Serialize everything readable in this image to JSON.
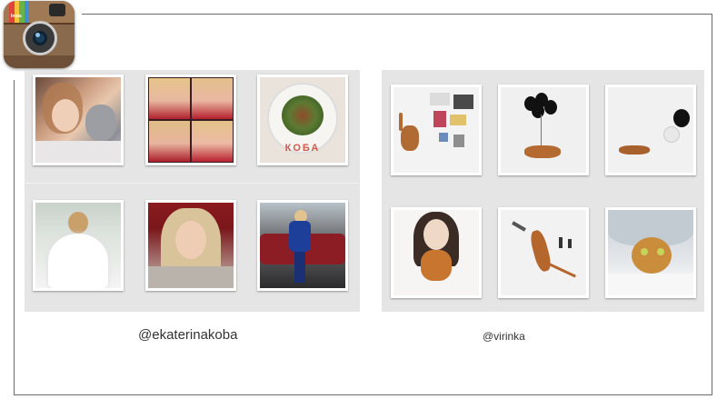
{
  "colors": {
    "frame": "#6b6b6b",
    "panel": "#e5e5e5",
    "text": "#333333"
  },
  "app_icon": {
    "name": "instagram-icon",
    "label": "Insta"
  },
  "profiles": [
    {
      "handle": "@ekaterinakoba",
      "photos": [
        {
          "name": "photo-selfie-with-cat"
        },
        {
          "name": "photo-collage-four-selfies"
        },
        {
          "name": "photo-salad-plate-koba"
        },
        {
          "name": "photo-bride-in-white-dress"
        },
        {
          "name": "photo-blonde-portrait"
        },
        {
          "name": "photo-woman-in-blue-by-car"
        }
      ],
      "plate_text": "КОБА"
    },
    {
      "handle": "@virinka",
      "photos": [
        {
          "name": "photo-cat-with-flatlay-items"
        },
        {
          "name": "photo-cat-with-black-balloons"
        },
        {
          "name": "photo-cat-with-balloon"
        },
        {
          "name": "photo-drawing-girl-with-cat"
        },
        {
          "name": "photo-cat-jumping"
        },
        {
          "name": "photo-cat-under-blanket"
        }
      ]
    }
  ]
}
